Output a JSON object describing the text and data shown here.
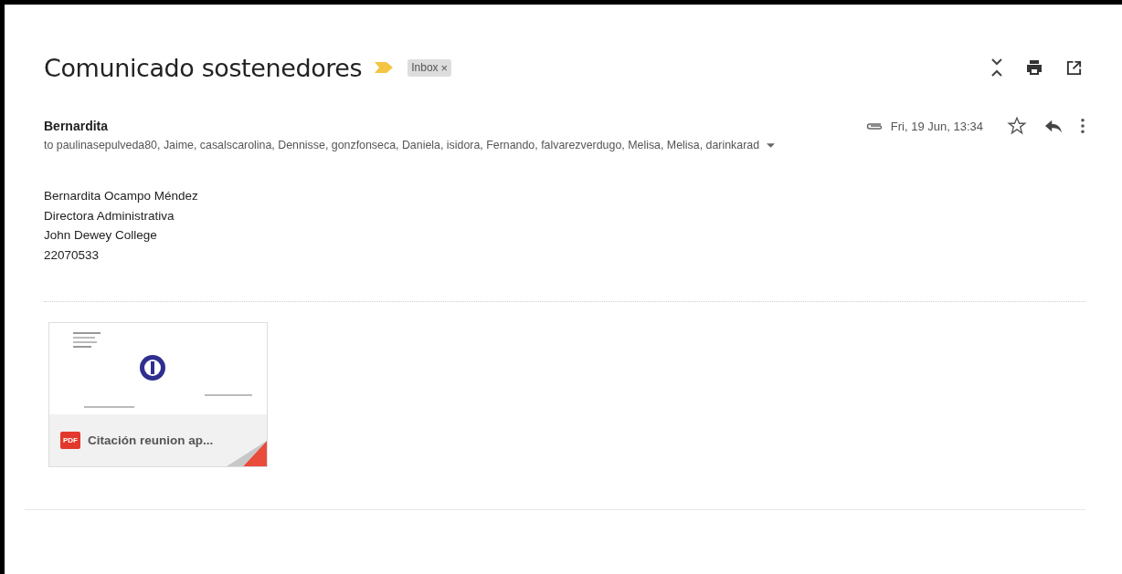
{
  "subject": "Comunicado sostenedores",
  "important": true,
  "labels": [
    {
      "text": "Inbox",
      "close": "×"
    }
  ],
  "sender": {
    "name": "Bernardita",
    "date": "Fri, 19 Jun, 13:34",
    "has_attachment": true,
    "starred": false
  },
  "recipients": "to paulinasepulveda80, Jaime, casalscarolina, Dennisse, gonzfonseca, Daniela, isidora, Fernando, falvarezverdugo, Melisa, Melisa, darinkarad",
  "body": [
    "Bernardita Ocampo Méndez",
    "Directora Administrativa",
    "John Dewey College",
    "22070533"
  ],
  "attachments": [
    {
      "badge": "PDF",
      "name": "Citación reunion ap..."
    }
  ]
}
